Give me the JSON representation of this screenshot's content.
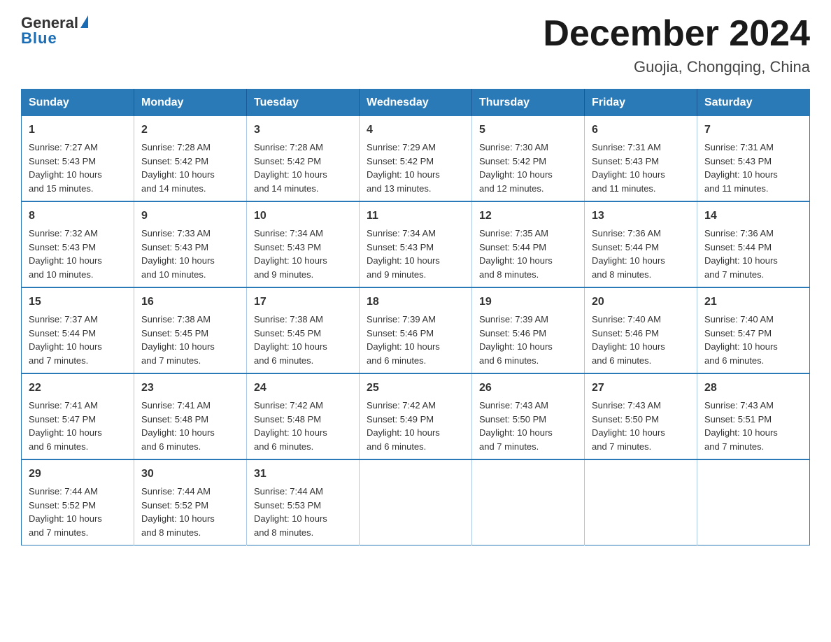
{
  "header": {
    "logo_general": "General",
    "logo_blue": "Blue",
    "month_title": "December 2024",
    "location": "Guojia, Chongqing, China"
  },
  "days_of_week": [
    "Sunday",
    "Monday",
    "Tuesday",
    "Wednesday",
    "Thursday",
    "Friday",
    "Saturday"
  ],
  "weeks": [
    [
      {
        "day": "1",
        "sunrise": "7:27 AM",
        "sunset": "5:43 PM",
        "daylight": "10 hours and 15 minutes."
      },
      {
        "day": "2",
        "sunrise": "7:28 AM",
        "sunset": "5:42 PM",
        "daylight": "10 hours and 14 minutes."
      },
      {
        "day": "3",
        "sunrise": "7:28 AM",
        "sunset": "5:42 PM",
        "daylight": "10 hours and 14 minutes."
      },
      {
        "day": "4",
        "sunrise": "7:29 AM",
        "sunset": "5:42 PM",
        "daylight": "10 hours and 13 minutes."
      },
      {
        "day": "5",
        "sunrise": "7:30 AM",
        "sunset": "5:42 PM",
        "daylight": "10 hours and 12 minutes."
      },
      {
        "day": "6",
        "sunrise": "7:31 AM",
        "sunset": "5:43 PM",
        "daylight": "10 hours and 11 minutes."
      },
      {
        "day": "7",
        "sunrise": "7:31 AM",
        "sunset": "5:43 PM",
        "daylight": "10 hours and 11 minutes."
      }
    ],
    [
      {
        "day": "8",
        "sunrise": "7:32 AM",
        "sunset": "5:43 PM",
        "daylight": "10 hours and 10 minutes."
      },
      {
        "day": "9",
        "sunrise": "7:33 AM",
        "sunset": "5:43 PM",
        "daylight": "10 hours and 10 minutes."
      },
      {
        "day": "10",
        "sunrise": "7:34 AM",
        "sunset": "5:43 PM",
        "daylight": "10 hours and 9 minutes."
      },
      {
        "day": "11",
        "sunrise": "7:34 AM",
        "sunset": "5:43 PM",
        "daylight": "10 hours and 9 minutes."
      },
      {
        "day": "12",
        "sunrise": "7:35 AM",
        "sunset": "5:44 PM",
        "daylight": "10 hours and 8 minutes."
      },
      {
        "day": "13",
        "sunrise": "7:36 AM",
        "sunset": "5:44 PM",
        "daylight": "10 hours and 8 minutes."
      },
      {
        "day": "14",
        "sunrise": "7:36 AM",
        "sunset": "5:44 PM",
        "daylight": "10 hours and 7 minutes."
      }
    ],
    [
      {
        "day": "15",
        "sunrise": "7:37 AM",
        "sunset": "5:44 PM",
        "daylight": "10 hours and 7 minutes."
      },
      {
        "day": "16",
        "sunrise": "7:38 AM",
        "sunset": "5:45 PM",
        "daylight": "10 hours and 7 minutes."
      },
      {
        "day": "17",
        "sunrise": "7:38 AM",
        "sunset": "5:45 PM",
        "daylight": "10 hours and 6 minutes."
      },
      {
        "day": "18",
        "sunrise": "7:39 AM",
        "sunset": "5:46 PM",
        "daylight": "10 hours and 6 minutes."
      },
      {
        "day": "19",
        "sunrise": "7:39 AM",
        "sunset": "5:46 PM",
        "daylight": "10 hours and 6 minutes."
      },
      {
        "day": "20",
        "sunrise": "7:40 AM",
        "sunset": "5:46 PM",
        "daylight": "10 hours and 6 minutes."
      },
      {
        "day": "21",
        "sunrise": "7:40 AM",
        "sunset": "5:47 PM",
        "daylight": "10 hours and 6 minutes."
      }
    ],
    [
      {
        "day": "22",
        "sunrise": "7:41 AM",
        "sunset": "5:47 PM",
        "daylight": "10 hours and 6 minutes."
      },
      {
        "day": "23",
        "sunrise": "7:41 AM",
        "sunset": "5:48 PM",
        "daylight": "10 hours and 6 minutes."
      },
      {
        "day": "24",
        "sunrise": "7:42 AM",
        "sunset": "5:48 PM",
        "daylight": "10 hours and 6 minutes."
      },
      {
        "day": "25",
        "sunrise": "7:42 AM",
        "sunset": "5:49 PM",
        "daylight": "10 hours and 6 minutes."
      },
      {
        "day": "26",
        "sunrise": "7:43 AM",
        "sunset": "5:50 PM",
        "daylight": "10 hours and 7 minutes."
      },
      {
        "day": "27",
        "sunrise": "7:43 AM",
        "sunset": "5:50 PM",
        "daylight": "10 hours and 7 minutes."
      },
      {
        "day": "28",
        "sunrise": "7:43 AM",
        "sunset": "5:51 PM",
        "daylight": "10 hours and 7 minutes."
      }
    ],
    [
      {
        "day": "29",
        "sunrise": "7:44 AM",
        "sunset": "5:52 PM",
        "daylight": "10 hours and 7 minutes."
      },
      {
        "day": "30",
        "sunrise": "7:44 AM",
        "sunset": "5:52 PM",
        "daylight": "10 hours and 8 minutes."
      },
      {
        "day": "31",
        "sunrise": "7:44 AM",
        "sunset": "5:53 PM",
        "daylight": "10 hours and 8 minutes."
      },
      null,
      null,
      null,
      null
    ]
  ],
  "labels": {
    "sunrise": "Sunrise:",
    "sunset": "Sunset:",
    "daylight": "Daylight:"
  }
}
